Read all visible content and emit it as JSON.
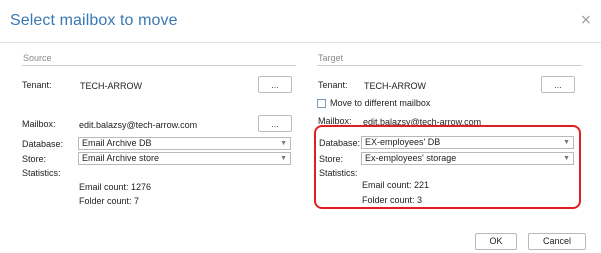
{
  "dialog": {
    "title": "Select mailbox to move",
    "close_glyph": "×"
  },
  "source": {
    "section_title": "Source",
    "tenant_label": "Tenant:",
    "tenant_value": "TECH-ARROW",
    "tenant_browse": "...",
    "mailbox_label": "Mailbox:",
    "mailbox_value": "edit.balazsy@tech-arrow.com",
    "mailbox_browse": "...",
    "database_label": "Database:",
    "database_value": "Email Archive DB",
    "store_label": "Store:",
    "store_value": "Email Archive store",
    "statistics_label": "Statistics:",
    "email_count": "Email count: 1276",
    "folder_count": "Folder count: 7"
  },
  "target": {
    "section_title": "Target",
    "tenant_label": "Tenant:",
    "tenant_value": "TECH-ARROW",
    "tenant_browse": "...",
    "move_checkbox_label": "Move to different mailbox",
    "move_checkbox_checked": false,
    "mailbox_label": "Mailbox:",
    "mailbox_value": "edit.balazsy@tech-arrow.com",
    "database_label": "Database:",
    "database_value": "EX-employees' DB",
    "store_label": "Store:",
    "store_value": "Ex-employees' storage",
    "statistics_label": "Statistics:",
    "email_count": "Email count: 221",
    "folder_count": "Folder count: 3"
  },
  "buttons": {
    "ok": "OK",
    "cancel": "Cancel"
  },
  "colors": {
    "title": "#3a78b4",
    "highlight": "#e02020"
  },
  "icons": {
    "close": "close-icon",
    "dropdown": "chevron-down-icon"
  }
}
